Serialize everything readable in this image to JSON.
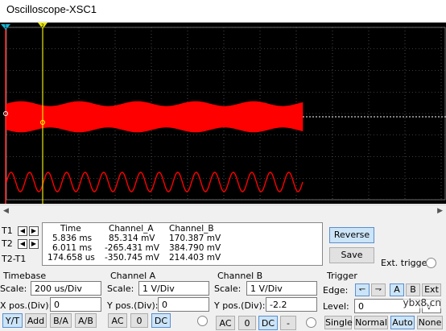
{
  "window": {
    "title": "Oscilloscope-XSC1"
  },
  "cursors": {
    "t1": "1",
    "t2": "2"
  },
  "readout": {
    "headers": [
      "Time",
      "Channel_A",
      "Channel_B"
    ],
    "rows": [
      {
        "label": "T1",
        "time": "5.836 ms",
        "a": "85.314 mV",
        "b": "170.387 mV"
      },
      {
        "label": "T2",
        "time": "6.011 ms",
        "a": "-265.431 mV",
        "b": "384.790 mV"
      },
      {
        "label": "T2-T1",
        "time": "174.658 us",
        "a": "-350.745 mV",
        "b": "214.403 mV"
      }
    ]
  },
  "actions": {
    "reverse": "Reverse",
    "save": "Save",
    "ext_trigger": "Ext. trigger"
  },
  "timebase": {
    "title": "Timebase",
    "scale_label": "Scale:",
    "scale": "200 us/Div",
    "xpos_label": "X pos.(Div):",
    "xpos": "0",
    "modes": [
      "Y/T",
      "Add",
      "B/A",
      "A/B"
    ],
    "active_mode": "Y/T"
  },
  "channel_a": {
    "title": "Channel A",
    "scale_label": "Scale:",
    "scale": "1  V/Div",
    "ypos_label": "Y pos.(Div):",
    "ypos": "0",
    "coupling": [
      "AC",
      "0",
      "DC"
    ],
    "active": "DC"
  },
  "channel_b": {
    "title": "Channel B",
    "scale_label": "Scale:",
    "scale": "1  V/Div",
    "ypos_label": "Y pos.(Div):",
    "ypos": "-2.2",
    "coupling": [
      "AC",
      "0",
      "DC",
      "-"
    ],
    "active": "DC"
  },
  "trigger": {
    "title": "Trigger",
    "edge_label": "Edge:",
    "level_label": "Level:",
    "level": "0",
    "level_unit": "V",
    "sources": [
      "A",
      "B",
      "Ext"
    ],
    "active_source": "A",
    "modes": [
      "Single",
      "Normal",
      "Auto",
      "None"
    ],
    "active_mode": "Auto"
  },
  "watermark": "ybx8.cn",
  "colors": {
    "trace": "#ff0000",
    "grid": "#808080",
    "cursor": "#e8e800",
    "screen": "#000000",
    "cursor_t1": "#19b5d5"
  }
}
